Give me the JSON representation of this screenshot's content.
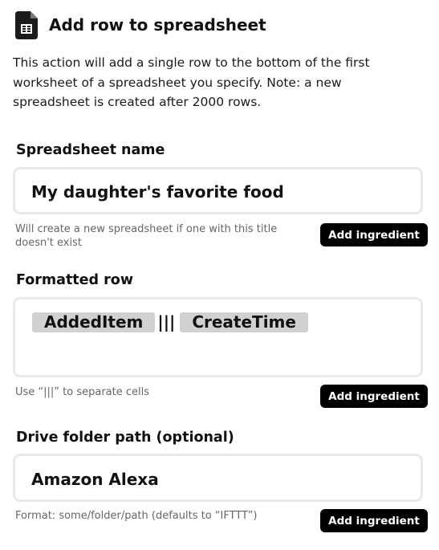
{
  "header": {
    "icon": "spreadsheet-icon",
    "title": "Add row to spreadsheet"
  },
  "description": "This action will add a single row to the bottom of the first worksheet of a spreadsheet you specify. Note: a new spreadsheet is created after 2000 rows.",
  "fields": {
    "spreadsheet_name": {
      "label": "Spreadsheet name",
      "value": "My daughter's favorite food",
      "helper": "Will create a new spreadsheet if one with this title doesn't exist",
      "button": "Add ingredient"
    },
    "formatted_row": {
      "label": "Formatted row",
      "ingredients": [
        "AddedItem",
        "CreateTime"
      ],
      "separator": "|||",
      "helper": "Use “|||” to separate cells",
      "button": "Add ingredient"
    },
    "drive_folder_path": {
      "label": "Drive folder path (optional)",
      "value": "Amazon Alexa",
      "helper": "Format: some/folder/path (defaults to “IFTTT”)",
      "button": "Add ingredient"
    }
  },
  "colors": {
    "button_bg": "#000000",
    "button_text": "#ffffff",
    "pill_bg": "#d1d1d1",
    "field_border": "#e9e9e9",
    "helper_text": "#666666"
  }
}
